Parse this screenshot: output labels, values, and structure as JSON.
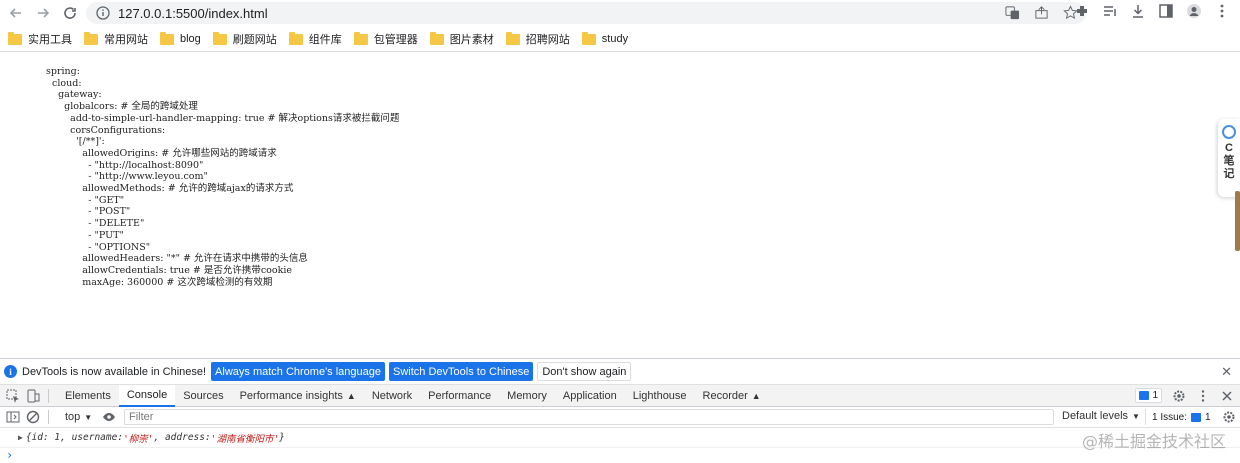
{
  "browser": {
    "url": "127.0.0.1:5500/index.html"
  },
  "bookmarks": [
    "实用工具",
    "常用网站",
    "blog",
    "刷题网站",
    "组件库",
    "包管理器",
    "图片素材",
    "招聘网站",
    "study"
  ],
  "yaml_lines": [
    "spring:",
    "  cloud:",
    "    gateway:",
    "      globalcors: # 全局的跨域处理",
    "        add-to-simple-url-handler-mapping: true # 解决options请求被拦截问题",
    "        corsConfigurations:",
    "          '[/**]':",
    "            allowedOrigins: # 允许哪些网站的跨域请求",
    "              - \"http://localhost:8090\"",
    "              - \"http://www.leyou.com\"",
    "            allowedMethods: # 允许的跨域ajax的请求方式",
    "              - \"GET\"",
    "              - \"POST\"",
    "              - \"DELETE\"",
    "              - \"PUT\"",
    "              - \"OPTIONS\"",
    "            allowedHeaders: \"*\" # 允许在请求中携带的头信息",
    "            allowCredentials: true # 是否允许携带cookie",
    "            maxAge: 360000 # 这次跨域检测的有效期"
  ],
  "extension": {
    "lines": [
      "C",
      "笔",
      "记"
    ]
  },
  "devtools": {
    "infobar": {
      "message": "DevTools is now available in Chinese!",
      "btn_match": "Always match Chrome's language",
      "btn_switch": "Switch DevTools to Chinese",
      "btn_dismiss": "Don't show again"
    },
    "tabs": [
      "Elements",
      "Console",
      "Sources",
      "Performance insights",
      "Network",
      "Performance",
      "Memory",
      "Application",
      "Lighthouse",
      "Recorder"
    ],
    "active_tab": "Console",
    "tab_badge_count": "1",
    "console": {
      "context": "top",
      "filter_placeholder": "Filter",
      "levels": "Default levels",
      "issues_label": "1 Issue:",
      "issues_count": "1"
    },
    "log": {
      "prefix": "{id: 1, username: ",
      "username": "'柳崇'",
      "mid": ", address: ",
      "address": "'湖南省衡阳市'",
      "suffix": "}"
    }
  },
  "watermark": "@稀土掘金技术社区",
  "colors": {
    "accent": "#1a73e8",
    "folder": "#f6c744",
    "string": "#c41a16"
  }
}
